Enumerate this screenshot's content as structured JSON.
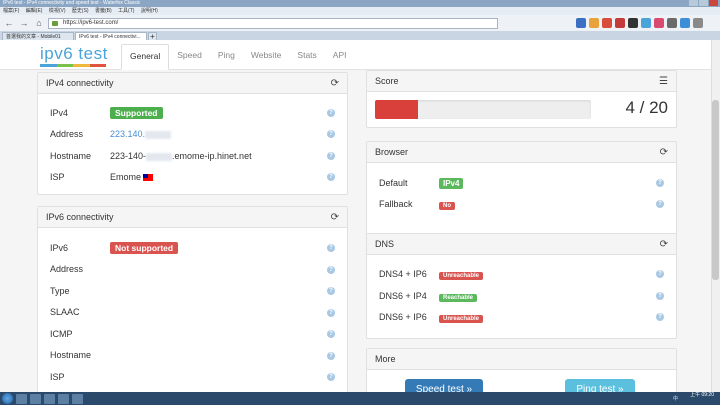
{
  "browser": {
    "title": "IPv6 test - IPv4 connectivity and speed test - Waterfox Classic",
    "menu": [
      "檔案(F)",
      "編輯(E)",
      "檢視(V)",
      "歷史(S)",
      "書籤(B)",
      "工具(T)",
      "說明(H)"
    ],
    "url": "https://ipv6-test.com/",
    "tabs": [
      {
        "label": "首選我的文章 - Mobile01"
      },
      {
        "label": "IPv6 test - IPv4 connectivi..."
      }
    ],
    "new_tab": "+"
  },
  "site": {
    "logo": "ipv6 test",
    "nav": [
      "General",
      "Speed",
      "Ping",
      "Website",
      "Stats",
      "API"
    ]
  },
  "ipv4": {
    "title": "IPv4 connectivity",
    "rows": [
      {
        "label": "IPv4",
        "value": "Supported"
      },
      {
        "label": "Address",
        "value": "223.140."
      },
      {
        "label": "Hostname",
        "value_pre": "223-140-",
        "value_post": ".emome-ip.hinet.net"
      },
      {
        "label": "ISP",
        "value": "Emome"
      }
    ]
  },
  "ipv6": {
    "title": "IPv6 connectivity",
    "rows": [
      {
        "label": "IPv6",
        "value": "Not supported"
      },
      {
        "label": "Address"
      },
      {
        "label": "Type"
      },
      {
        "label": "SLAAC"
      },
      {
        "label": "ICMP"
      },
      {
        "label": "Hostname"
      },
      {
        "label": "ISP"
      }
    ]
  },
  "score": {
    "title": "Score",
    "value": "4 / 20",
    "progress_fraction": 0.2
  },
  "browser_panel": {
    "title": "Browser",
    "rows": [
      {
        "label": "Default",
        "value": "IPv4"
      },
      {
        "label": "Fallback",
        "value": "No"
      }
    ]
  },
  "dns": {
    "title": "DNS",
    "rows": [
      {
        "label": "DNS4 + IP6",
        "value": "Unreachable"
      },
      {
        "label": "DNS6 + IP4",
        "value": "Reachable"
      },
      {
        "label": "DNS6 + IP6",
        "value": "Unreachable"
      }
    ]
  },
  "more": {
    "title": "More",
    "speed_button": "Speed test »",
    "ping_button": "Ping test »"
  },
  "help_glyph": "?",
  "taskbar": {
    "clock_time": "上午 09:20",
    "tray_lang": "中"
  },
  "colors": {
    "ok": "#4cae4c",
    "bad": "#d9534f",
    "accent": "#4aa3d9"
  }
}
